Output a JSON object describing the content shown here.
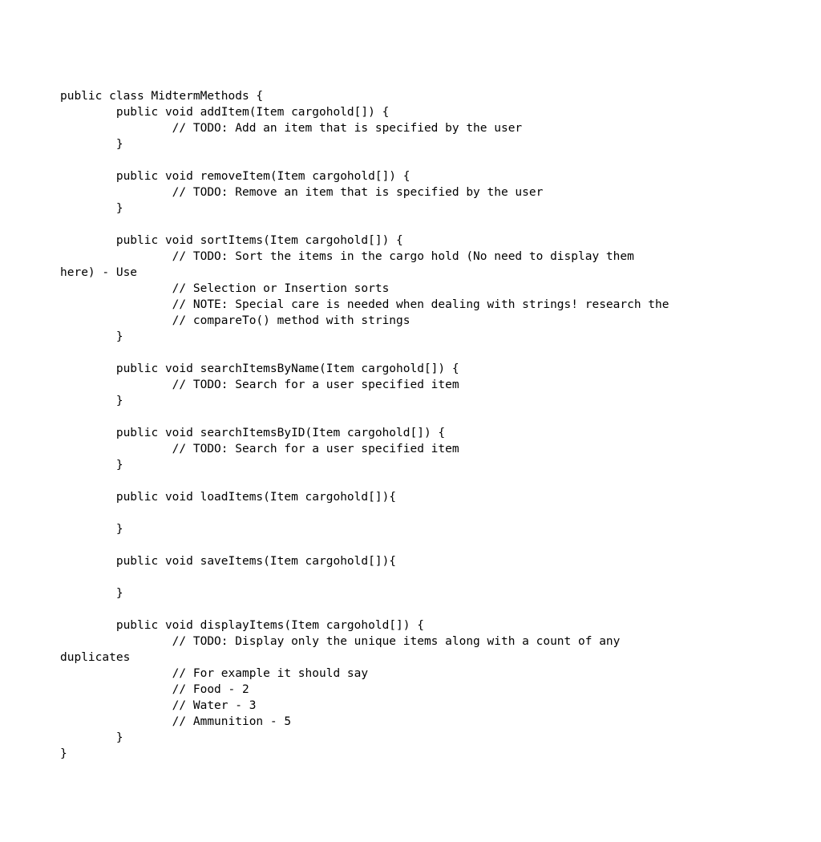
{
  "code": {
    "lines": [
      "public class MidtermMethods {",
      "        public void addItem(Item cargohold[]) {",
      "                // TODO: Add an item that is specified by the user",
      "        }",
      "",
      "        public void removeItem(Item cargohold[]) {",
      "                // TODO: Remove an item that is specified by the user",
      "        }",
      "",
      "        public void sortItems(Item cargohold[]) {",
      "                // TODO: Sort the items in the cargo hold (No need to display them",
      "here) - Use",
      "                // Selection or Insertion sorts",
      "                // NOTE: Special care is needed when dealing with strings! research the",
      "                // compareTo() method with strings",
      "        }",
      "",
      "        public void searchItemsByName(Item cargohold[]) {",
      "                // TODO: Search for a user specified item",
      "        }",
      "",
      "        public void searchItemsByID(Item cargohold[]) {",
      "                // TODO: Search for a user specified item",
      "        }",
      "",
      "        public void loadItems(Item cargohold[]){",
      "",
      "        }",
      "",
      "        public void saveItems(Item cargohold[]){",
      "",
      "        }",
      "",
      "        public void displayItems(Item cargohold[]) {",
      "                // TODO: Display only the unique items along with a count of any",
      "duplicates",
      "                // For example it should say",
      "                // Food - 2",
      "                // Water - 3",
      "                // Ammunition - 5",
      "        }",
      "}"
    ]
  }
}
